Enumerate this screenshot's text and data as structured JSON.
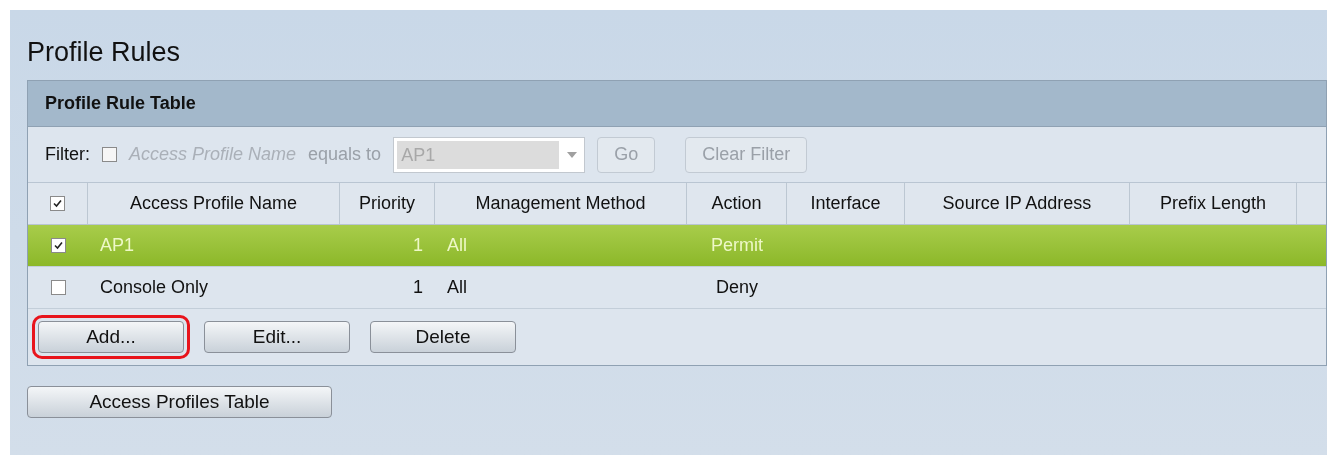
{
  "page": {
    "title": "Profile Rules"
  },
  "table": {
    "title": "Profile Rule Table",
    "filter": {
      "label": "Filter:",
      "checked": false,
      "field": "Access Profile Name",
      "operator": "equals to",
      "value": "AP1",
      "buttons": [
        {
          "label": "Go",
          "disabled": true
        },
        {
          "label": "Clear Filter",
          "disabled": true
        }
      ]
    },
    "select_all": true,
    "columns": [
      "Access Profile Name",
      "Priority",
      "Management Method",
      "Action",
      "Interface",
      "Source IP Address",
      "Prefix Length"
    ],
    "rows": [
      {
        "selected": true,
        "checked": true,
        "cells": [
          "AP1",
          "1",
          "All",
          "Permit",
          "",
          "",
          ""
        ]
      },
      {
        "selected": false,
        "checked": false,
        "cells": [
          "Console Only",
          "1",
          "All",
          "Deny",
          "",
          "",
          ""
        ]
      }
    ],
    "actions": [
      {
        "label": "Add...",
        "highlighted": true
      },
      {
        "label": "Edit...",
        "highlighted": false
      },
      {
        "label": "Delete",
        "highlighted": false
      }
    ]
  },
  "footer_button": "Access Profiles Table"
}
